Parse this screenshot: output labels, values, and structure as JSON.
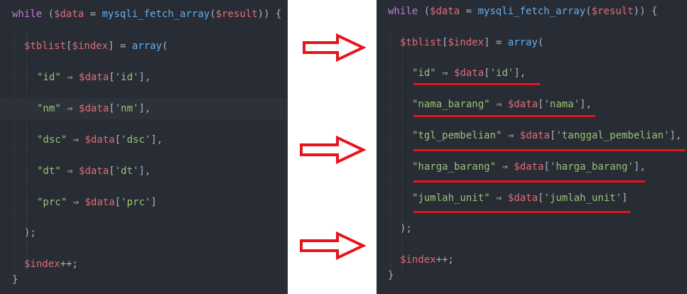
{
  "left_code": {
    "line1": {
      "kw": "while",
      "p1": " (",
      "v1": "$data",
      "p2": " = ",
      "f1": "mysqli_fetch_array",
      "p3": "(",
      "v2": "$result",
      "p4": ")) {"
    },
    "line2": {
      "v1": "$tblist",
      "p1": "[",
      "v2": "$index",
      "p2": "] = ",
      "f1": "array",
      "p3": "("
    },
    "entries": [
      {
        "key": "\"id\"",
        "arrow": " ⇒ ",
        "var": "$data",
        "ob": "[",
        "idx": "'id'",
        "cb": "],"
      },
      {
        "key": "\"nm\"",
        "arrow": " ⇒ ",
        "var": "$data",
        "ob": "[",
        "idx": "'nm'",
        "cb": "],"
      },
      {
        "key": "\"dsc\"",
        "arrow": " ⇒ ",
        "var": "$data",
        "ob": "[",
        "idx": "'dsc'",
        "cb": "],"
      },
      {
        "key": "\"dt\"",
        "arrow": " ⇒ ",
        "var": "$data",
        "ob": "[",
        "idx": "'dt'",
        "cb": "],"
      },
      {
        "key": "\"prc\"",
        "arrow": " ⇒ ",
        "var": "$data",
        "ob": "[",
        "idx": "'prc'",
        "cb": "]"
      }
    ],
    "close_paren": ");",
    "increment": {
      "v": "$index",
      "op": "++;"
    },
    "close_brace": "}"
  },
  "right_code": {
    "line1": {
      "kw": "while",
      "p1": " (",
      "v1": "$data",
      "p2": " = ",
      "f1": "mysqli_fetch_array",
      "p3": "(",
      "v2": "$result",
      "p4": ")) {"
    },
    "line2": {
      "v1": "$tblist",
      "p1": "[",
      "v2": "$index",
      "p2": "] = ",
      "f1": "array",
      "p3": "("
    },
    "entries": [
      {
        "key": "\"id\"",
        "arrow": " ⇒ ",
        "var": "$data",
        "ob": "[",
        "idx": "'id'",
        "cb": "],"
      },
      {
        "key": "\"nama_barang\"",
        "arrow": " ⇒ ",
        "var": "$data",
        "ob": "[",
        "idx": "'nama'",
        "cb": "],"
      },
      {
        "key": "\"tgl_pembelian\"",
        "arrow": " ⇒ ",
        "var": "$data",
        "ob": "[",
        "idx": "'tanggal_pembelian'",
        "cb": "],"
      },
      {
        "key": "\"harga_barang\"",
        "arrow": " ⇒ ",
        "var": "$data",
        "ob": "[",
        "idx": "'harga_barang'",
        "cb": "],"
      },
      {
        "key": "\"jumlah_unit\"",
        "arrow": " ⇒ ",
        "var": "$data",
        "ob": "[",
        "idx": "'jumlah_unit'",
        "cb": "]"
      }
    ],
    "close_paren": ");",
    "increment": {
      "v": "$index",
      "op": "++;"
    },
    "close_brace": "}"
  },
  "colors": {
    "editor_bg": "#282c34",
    "keyword": "#c678dd",
    "variable": "#e06c75",
    "function": "#61afef",
    "string": "#98c379",
    "punctuation": "#abb2bf",
    "annotation_red": "#e8141b"
  },
  "icons": {
    "arrow": "right-arrow-icon",
    "underline": "red-underline-annotation"
  }
}
